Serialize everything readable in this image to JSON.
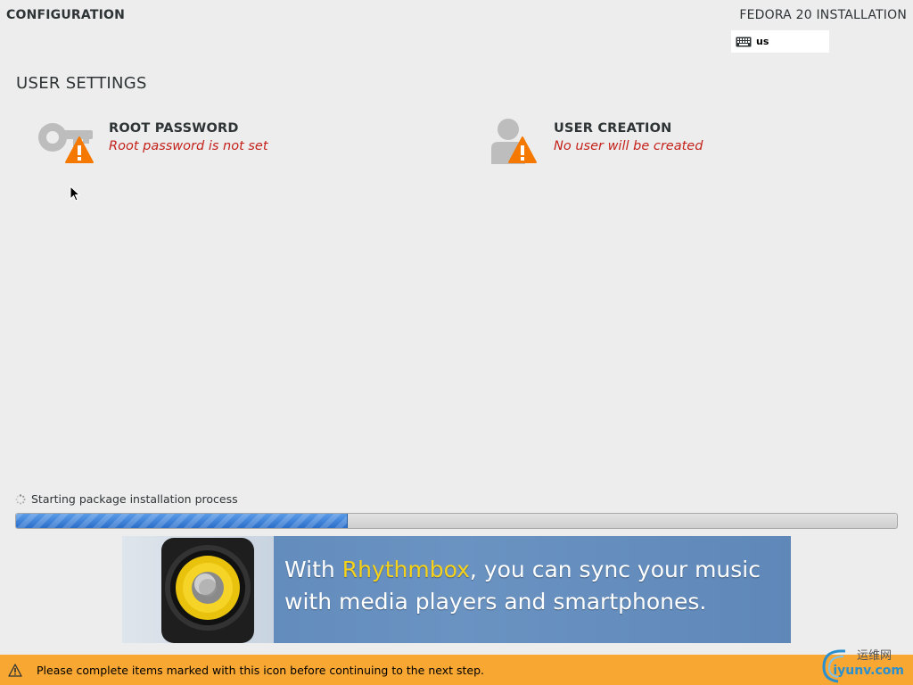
{
  "header": {
    "section": "CONFIGURATION",
    "product": "FEDORA 20 INSTALLATION",
    "keyboard_layout": "us"
  },
  "user_settings": {
    "title": "USER SETTINGS",
    "root": {
      "title": "ROOT PASSWORD",
      "status": "Root password is not set"
    },
    "user": {
      "title": "USER CREATION",
      "status": "No user will be created"
    }
  },
  "progress": {
    "message": "Starting package installation process",
    "fraction": 0.375
  },
  "banner": {
    "line1_pre": "With ",
    "line1_highlight": "Rhythmbox",
    "line1_post": ", you can sync your music",
    "line2": "with media players and smartphones."
  },
  "footer": {
    "message": "Please complete items marked with this icon before continuing to the next step."
  },
  "watermark": {
    "top": "运维网",
    "bottom": "iyunv.com"
  },
  "colors": {
    "warning_orange": "#f57900",
    "status_red": "#c4221b",
    "footer_bg": "#f9a733",
    "progress_blue": "#3d84d9"
  }
}
